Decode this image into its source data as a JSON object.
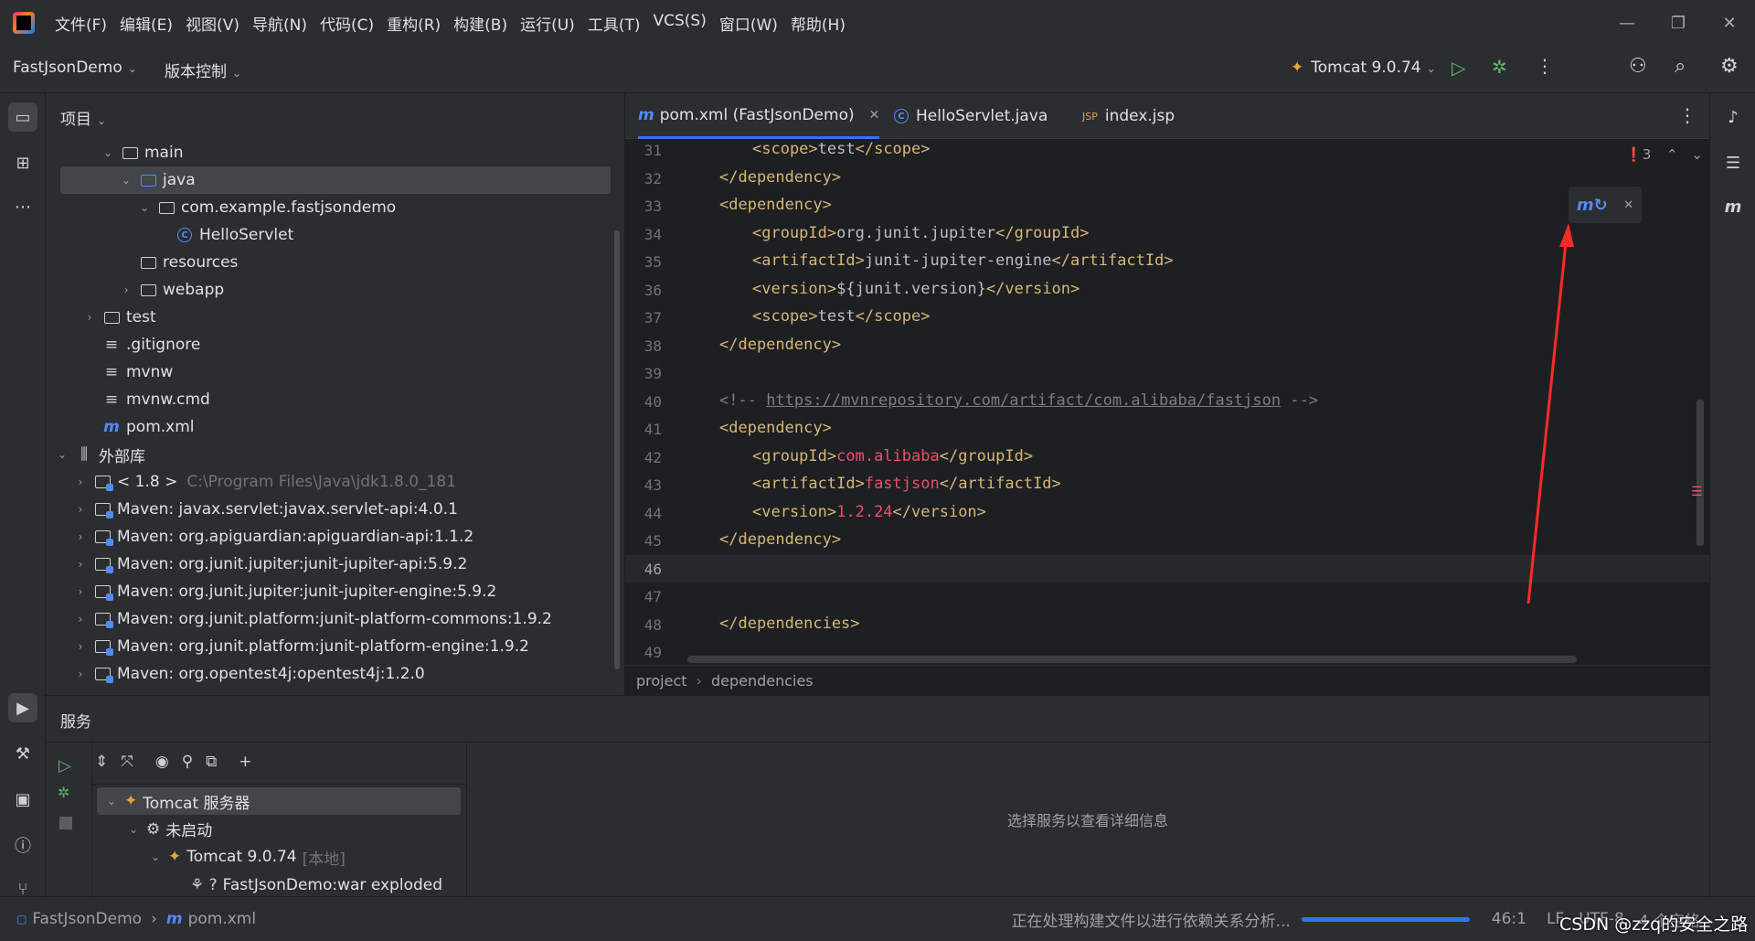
{
  "menubar": {
    "items": [
      "文件(F)",
      "编辑(E)",
      "视图(V)",
      "导航(N)",
      "代码(C)",
      "重构(R)",
      "构建(B)",
      "运行(U)",
      "工具(T)",
      "VCS(S)",
      "窗口(W)",
      "帮助(H)"
    ]
  },
  "toolbar": {
    "project_name": "FastJsonDemo",
    "vcs_label": "版本控制",
    "run_config": "Tomcat 9.0.74"
  },
  "project_panel": {
    "title": "项目",
    "tree": [
      {
        "label": "main",
        "type": "folder",
        "expanded": true
      },
      {
        "label": "java",
        "type": "folder-blue",
        "expanded": true,
        "selected": true
      },
      {
        "label": "com.example.fastjsondemo",
        "type": "package",
        "expanded": true
      },
      {
        "label": "HelloServlet",
        "type": "class"
      },
      {
        "label": "resources",
        "type": "folder"
      },
      {
        "label": "webapp",
        "type": "folder",
        "expanded": false
      },
      {
        "label": "test",
        "type": "folder",
        "expanded": false
      },
      {
        "label": ".gitignore",
        "type": "file"
      },
      {
        "label": "mvnw",
        "type": "file"
      },
      {
        "label": "mvnw.cmd",
        "type": "file"
      },
      {
        "label": "pom.xml",
        "type": "maven"
      },
      {
        "label": "外部库",
        "type": "lib-root",
        "expanded": true
      },
      {
        "label": "< 1.8 >",
        "suffix": "C:\\Program Files\\Java\\jdk1.8.0_181",
        "type": "lib"
      },
      {
        "label": "Maven: javax.servlet:javax.servlet-api:4.0.1",
        "type": "lib"
      },
      {
        "label": "Maven: org.apiguardian:apiguardian-api:1.1.2",
        "type": "lib"
      },
      {
        "label": "Maven: org.junit.jupiter:junit-jupiter-api:5.9.2",
        "type": "lib"
      },
      {
        "label": "Maven: org.junit.jupiter:junit-jupiter-engine:5.9.2",
        "type": "lib"
      },
      {
        "label": "Maven: org.junit.platform:junit-platform-commons:1.9.2",
        "type": "lib"
      },
      {
        "label": "Maven: org.junit.platform:junit-platform-engine:1.9.2",
        "type": "lib"
      },
      {
        "label": "Maven: org.opentest4j:opentest4j:1.2.0",
        "type": "lib"
      }
    ]
  },
  "editor": {
    "tabs": [
      {
        "label": "pom.xml (FastJsonDemo)",
        "active": true
      },
      {
        "label": "HelloServlet.java",
        "active": false
      },
      {
        "label": "index.jsp",
        "active": false
      }
    ],
    "problems_count": "3",
    "lines": [
      {
        "n": "31",
        "indent": 2,
        "parts": [
          [
            "tag",
            "<scope>"
          ],
          [
            "txt",
            "test"
          ],
          [
            "tag",
            "</scope>"
          ]
        ]
      },
      {
        "n": "32",
        "indent": 1,
        "parts": [
          [
            "tag",
            "</dependency>"
          ]
        ]
      },
      {
        "n": "33",
        "indent": 1,
        "parts": [
          [
            "tag",
            "<dependency>"
          ]
        ]
      },
      {
        "n": "34",
        "indent": 2,
        "parts": [
          [
            "tag",
            "<groupId>"
          ],
          [
            "txt",
            "org.junit.jupiter"
          ],
          [
            "tag",
            "</groupId>"
          ]
        ]
      },
      {
        "n": "35",
        "indent": 2,
        "parts": [
          [
            "tag",
            "<artifactId>"
          ],
          [
            "txt",
            "junit-jupiter-engine"
          ],
          [
            "tag",
            "</artifactId>"
          ]
        ]
      },
      {
        "n": "36",
        "indent": 2,
        "parts": [
          [
            "tag",
            "<version>"
          ],
          [
            "txt",
            "${junit.version}"
          ],
          [
            "tag",
            "</version>"
          ]
        ]
      },
      {
        "n": "37",
        "indent": 2,
        "parts": [
          [
            "tag",
            "<scope>"
          ],
          [
            "txt",
            "test"
          ],
          [
            "tag",
            "</scope>"
          ]
        ]
      },
      {
        "n": "38",
        "indent": 1,
        "parts": [
          [
            "tag",
            "</dependency>"
          ]
        ]
      },
      {
        "n": "39",
        "indent": 0,
        "parts": []
      },
      {
        "n": "40",
        "indent": 1,
        "parts": [
          [
            "cmt",
            "<!-- "
          ],
          [
            "link",
            "https://mvnrepository.com/artifact/com.alibaba/fastjson"
          ],
          [
            "cmt",
            " -->"
          ]
        ]
      },
      {
        "n": "41",
        "indent": 1,
        "parts": [
          [
            "tag",
            "<dependency>"
          ]
        ]
      },
      {
        "n": "42",
        "indent": 2,
        "parts": [
          [
            "tag",
            "<groupId>"
          ],
          [
            "val",
            "com.alibaba"
          ],
          [
            "tag",
            "</groupId>"
          ]
        ]
      },
      {
        "n": "43",
        "indent": 2,
        "parts": [
          [
            "tag",
            "<artifactId>"
          ],
          [
            "val",
            "fastjson"
          ],
          [
            "tag",
            "</artifactId>"
          ]
        ]
      },
      {
        "n": "44",
        "indent": 2,
        "parts": [
          [
            "tag",
            "<version>"
          ],
          [
            "val",
            "1.2.24"
          ],
          [
            "tag",
            "</version>"
          ]
        ]
      },
      {
        "n": "45",
        "indent": 1,
        "parts": [
          [
            "tag",
            "</dependency>"
          ]
        ]
      },
      {
        "n": "46",
        "indent": 0,
        "parts": [],
        "current": true
      },
      {
        "n": "47",
        "indent": 0,
        "parts": []
      },
      {
        "n": "48",
        "indent": 0,
        "parts": [
          [
            "tag",
            "</dependencies>"
          ]
        ]
      },
      {
        "n": "49",
        "indent": 0,
        "parts": []
      }
    ],
    "breadcrumb": [
      "project",
      "dependencies"
    ]
  },
  "services": {
    "title": "服务",
    "tree": [
      {
        "label": "Tomcat 服务器",
        "level": 0,
        "selected": true
      },
      {
        "label": "未启动",
        "level": 1
      },
      {
        "label": "Tomcat 9.0.74",
        "suffix": "[本地]",
        "level": 2
      },
      {
        "label": "FastJsonDemo:war exploded",
        "level": 3
      }
    ],
    "detail_placeholder": "选择服务以查看详细信息"
  },
  "statusbar": {
    "crumbs": [
      "FastJsonDemo",
      "pom.xml"
    ],
    "task": "正在处理构建文件以进行依赖关系分析...",
    "task_progress": 1.0,
    "position": "46:1",
    "line_sep": "LF",
    "encoding": "UTF-8",
    "indent": "4 个空格"
  },
  "watermark": "CSDN @zzq的安全之路",
  "colors": {
    "accent": "#3574f0",
    "annotation_arrow": "#ff2a2a"
  }
}
